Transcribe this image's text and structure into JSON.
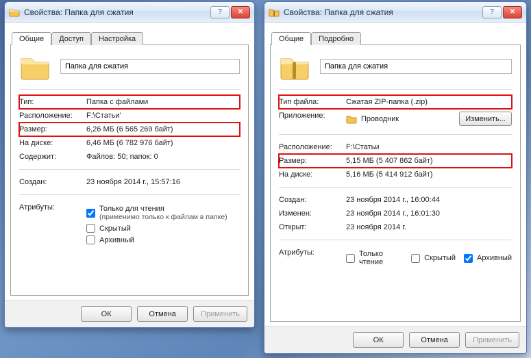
{
  "left": {
    "title": "Свойства: Папка для сжатия",
    "tabs": {
      "general": "Общие",
      "access": "Доступ",
      "settings": "Настройка"
    },
    "name_value": "Папка для сжатия",
    "rows": {
      "type_label": "Тип:",
      "type_value": "Папка с файлами",
      "loc_label": "Расположение:",
      "loc_value": "F:\\Статьи'",
      "size_label": "Размер:",
      "size_value": "6,26 МБ (6 565 269 байт)",
      "ondisk_label": "На диске:",
      "ondisk_value": "6,46 МБ (6 782 976 байт)",
      "contains_label": "Содержит:",
      "contains_value": "Файлов: 50; папок: 0",
      "created_label": "Создан:",
      "created_value": "23 ноября 2014 г., 15:57:16",
      "attr_label": "Атрибуты:"
    },
    "attrs": {
      "readonly_label": "Только для чтения",
      "readonly_sub": "(применимо только к файлам в папке)",
      "hidden_label": "Скрытый",
      "archive_label": "Архивный"
    },
    "buttons": {
      "ok": "ОК",
      "cancel": "Отмена",
      "apply": "Применить"
    }
  },
  "right": {
    "title": "Свойства: Папка для сжатия",
    "tabs": {
      "general": "Общие",
      "details": "Подробно"
    },
    "name_value": "Папка для сжатия",
    "rows": {
      "type_label": "Тип файла:",
      "type_value": "Сжатая ZIP-папка (.zip)",
      "app_label": "Приложение:",
      "app_value": "Проводник",
      "change_btn": "Изменить...",
      "loc_label": "Расположение:",
      "loc_value": "F:\\Статьи",
      "size_label": "Размер:",
      "size_value": "5,15 МБ (5 407 862 байт)",
      "ondisk_label": "На диске:",
      "ondisk_value": "5,16 МБ (5 414 912 байт)",
      "created_label": "Создан:",
      "created_value": "23 ноября 2014 г., 16:00:44",
      "modified_label": "Изменен:",
      "modified_value": "23 ноября 2014 г., 16:01:30",
      "opened_label": "Открыт:",
      "opened_value": "23 ноября 2014 г.",
      "attr_label": "Атрибуты:"
    },
    "attrs": {
      "readonly_label": "Только чтение",
      "hidden_label": "Скрытый",
      "archive_label": "Архивный"
    },
    "buttons": {
      "ok": "ОК",
      "cancel": "Отмена",
      "apply": "Применить"
    }
  }
}
